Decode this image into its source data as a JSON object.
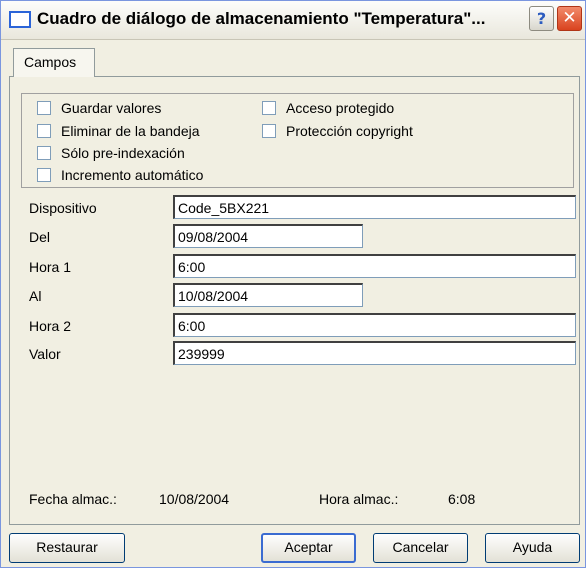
{
  "window": {
    "title": "Cuadro de diálogo de almacenamiento \"Temperatura\"...",
    "help_button": "?",
    "close_button": "✕"
  },
  "tabs": [
    {
      "label": "Campos",
      "active": true
    }
  ],
  "options": [
    {
      "label": "Guardar valores",
      "checked": false
    },
    {
      "label": "Eliminar de la bandeja",
      "checked": false
    },
    {
      "label": "Sólo pre-indexación",
      "checked": false
    },
    {
      "label": "Incremento automático",
      "checked": false
    },
    {
      "label": "Acceso protegido",
      "checked": false
    },
    {
      "label": "Protección copyright",
      "checked": false
    }
  ],
  "fields": [
    {
      "label": "Dispositivo",
      "value": "Code_5BX221"
    },
    {
      "label": "Del",
      "value": "09/08/2004"
    },
    {
      "label": "Hora 1",
      "value": "6:00"
    },
    {
      "label": "Al",
      "value": "10/08/2004"
    },
    {
      "label": "Hora 2",
      "value": "6:00"
    },
    {
      "label": "Valor",
      "value": "239999"
    }
  ],
  "info": {
    "fecha_label": "Fecha almac.:",
    "fecha_value": "10/08/2004",
    "hora_label": "Hora almac.:",
    "hora_value": "6:08"
  },
  "buttons": {
    "restaurar": "Restaurar",
    "aceptar": "Aceptar",
    "cancelar": "Cancelar",
    "ayuda": "Ayuda"
  }
}
